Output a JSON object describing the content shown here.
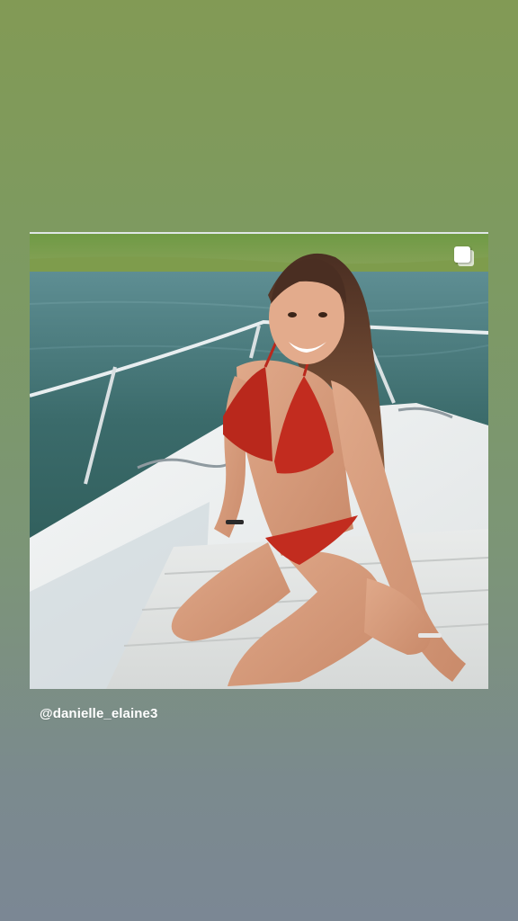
{
  "story": {
    "mention": "@danielle_elaine3",
    "background_top_color": "#829a55",
    "background_bottom_color": "#7b8794"
  },
  "post": {
    "media_icon": "multiple-photos-icon",
    "photo_subject": "woman-in-red-bikini-on-boat-bow"
  }
}
